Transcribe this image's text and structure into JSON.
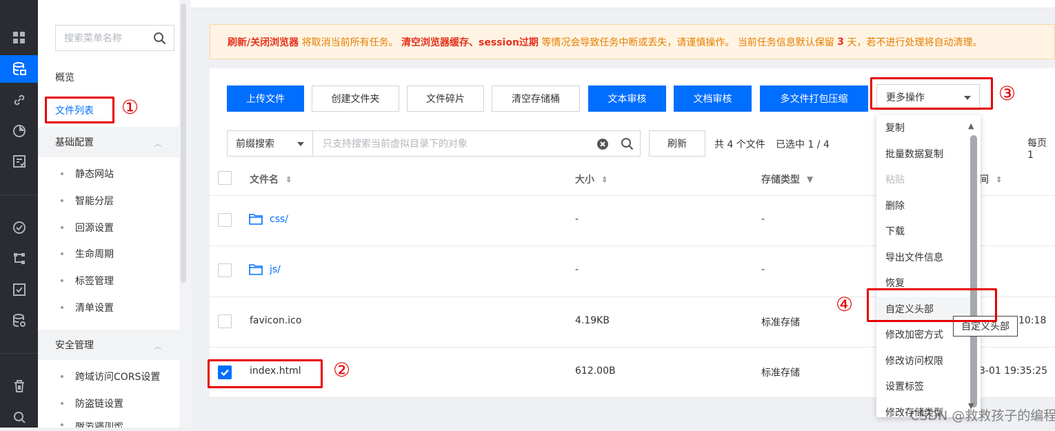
{
  "sidebar": {
    "search_placeholder": "搜索菜单名称",
    "overview": "概览",
    "file_list": "文件列表",
    "basic_config": "基础配置",
    "basic_items": [
      "静态网站",
      "智能分层",
      "回源设置",
      "生命周期",
      "标签管理",
      "清单设置"
    ],
    "security": "安全管理",
    "security_items": [
      "跨域访问CORS设置",
      "防盗链设置",
      "服务端加密"
    ]
  },
  "banner": {
    "part1": "刷新/关闭浏览器",
    "part2": " 将取消当前所有任务。 ",
    "part3": "清空浏览器缓存、session过期",
    "part4": " 等情况会导致任务中断或丢失，请谨慎操作。 当前任务信息默认保留 ",
    "part5": "3",
    "part6": " 天，若不进行处理将自动清理。"
  },
  "toolbar": {
    "upload": "上传文件",
    "create_folder": "创建文件夹",
    "fragments": "文件碎片",
    "clear_bucket": "清空存储桶",
    "text_review": "文本审核",
    "doc_review": "文档审核",
    "multi_zip": "多文件打包压缩",
    "more": "更多操作"
  },
  "search": {
    "prefix": "前缀搜索",
    "placeholder": "只支持搜索当前虚拟目录下的对象",
    "refresh": "刷新",
    "count": "共 4 个文件",
    "selected": "已选中 1 / 4",
    "per_page": "每页 1"
  },
  "table": {
    "headers": {
      "name": "文件名",
      "size": "大小",
      "storage": "存储类型",
      "time_tail": "间"
    },
    "rows": [
      {
        "name": "css/",
        "size": "-",
        "storage": "-",
        "time": ""
      },
      {
        "name": "js/",
        "size": "-",
        "storage": "-",
        "time": ""
      },
      {
        "name": "favicon.ico",
        "size": "4.19KB",
        "storage": "标准存储",
        "time": "10:18"
      },
      {
        "name": "index.html",
        "size": "612.00B",
        "storage": "标准存储",
        "time": "3-01 19:35:25"
      }
    ]
  },
  "menu": {
    "items": [
      "复制",
      "批量数据复制",
      "粘贴",
      "删除",
      "下载",
      "导出文件信息",
      "恢复",
      "自定义头部",
      "修改加密方式",
      "修改访问权限",
      "设置标签",
      "修改存储类型"
    ],
    "tooltip": "自定义头部"
  },
  "annotations": [
    "①",
    "②",
    "③",
    "④"
  ],
  "watermark": "CSDN @救救孩子的编程",
  "colors": {
    "primary": "#006eff",
    "annotation": "#e60000",
    "rail": "#2a2c31"
  }
}
